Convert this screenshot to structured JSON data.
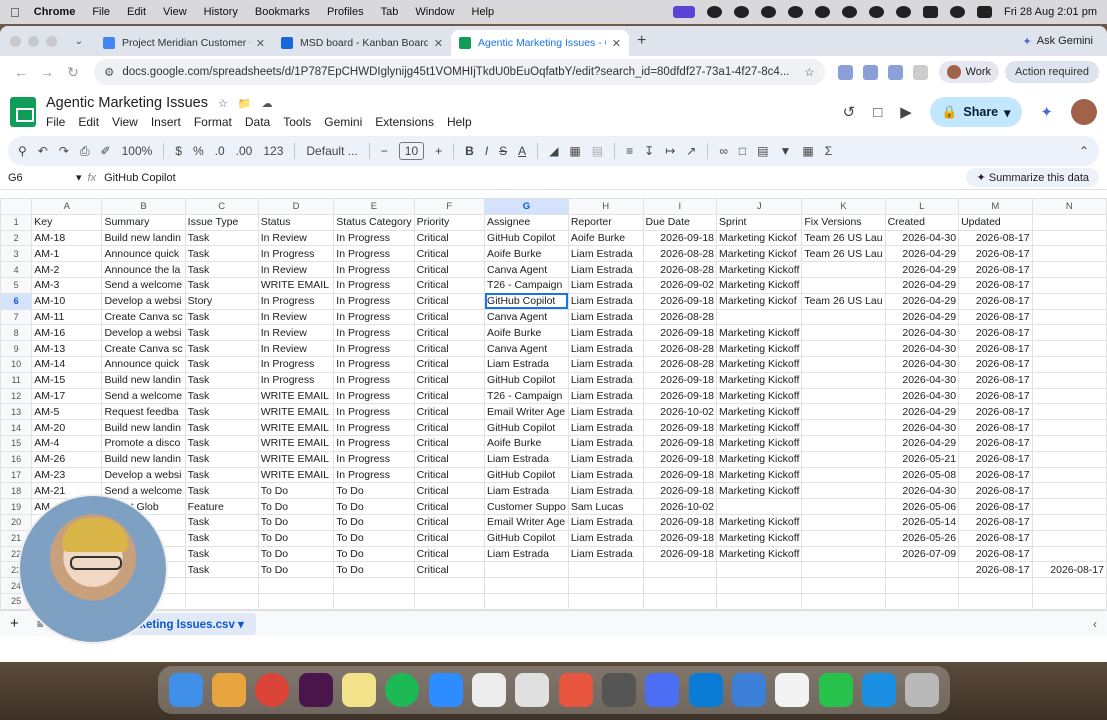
{
  "menubar": {
    "app": "Chrome",
    "items": [
      "File",
      "Edit",
      "View",
      "History",
      "Bookmarks",
      "Profiles",
      "Tab",
      "Window",
      "Help"
    ],
    "clock": "Fri 28 Aug  2:01 pm"
  },
  "tabs": [
    {
      "title": "Project Meridian Customer O",
      "color": "#4285f4"
    },
    {
      "title": "MSD board - Kanban Board -",
      "color": "#1868db"
    },
    {
      "title": "Agentic Marketing Issues - G",
      "color": "#0f9d58",
      "active": true
    }
  ],
  "ask_gemini": "Ask Gemini",
  "url": "docs.google.com/spreadsheets/d/1P787EpCHWDIglynijg45t1VOMHIjTkdU0bEuOqfatbY/edit?search_id=80dfdf27-73a1-4f27-8c4...",
  "profile_label": "Work",
  "action_required": "Action required",
  "doc": {
    "title": "Agentic Marketing Issues",
    "menus": [
      "File",
      "Edit",
      "View",
      "Insert",
      "Format",
      "Data",
      "Tools",
      "Gemini",
      "Extensions",
      "Help"
    ],
    "share": "Share"
  },
  "toolbar": {
    "zoom": "100%",
    "currency": "$",
    "percent": "%",
    "dec_minus": ".0",
    "dec_plus": ".00",
    "num_format": "123",
    "font": "Default ...",
    "font_size": "10"
  },
  "formula_bar": {
    "cell": "G6",
    "value": "GitHub Copilot",
    "summarize": "Summarize this data"
  },
  "grid": {
    "columns": [
      "A",
      "B",
      "C",
      "D",
      "E",
      "F",
      "G",
      "H",
      "I",
      "J",
      "K",
      "L",
      "M",
      "N"
    ],
    "rows": [
      [
        "1",
        "Key",
        "Summary",
        "Issue Type",
        "Status",
        "Status Category",
        "Priority",
        "Assignee",
        "Reporter",
        "Due Date",
        "Sprint",
        "Fix Versions",
        "Created",
        "Updated",
        ""
      ],
      [
        "2",
        "AM-18",
        "Build new landin",
        "Task",
        "In Review",
        "In Progress",
        "Critical",
        "GitHub Copilot",
        "Aoife Burke",
        "2026-09-18",
        "Marketing Kickof",
        "Team 26 US Lau",
        "2026-04-30",
        "2026-08-17",
        ""
      ],
      [
        "3",
        "AM-1",
        "Announce quick",
        "Task",
        "In Progress",
        "In Progress",
        "Critical",
        "Aoife Burke",
        "Liam Estrada",
        "2026-08-28",
        "Marketing Kickof",
        "Team 26 US Lau",
        "2026-04-29",
        "2026-08-17",
        ""
      ],
      [
        "4",
        "AM-2",
        "Announce the la",
        "Task",
        "In Review",
        "In Progress",
        "Critical",
        "Canva Agent",
        "Liam Estrada",
        "2026-08-28",
        "Marketing Kickoff",
        "",
        "2026-04-29",
        "2026-08-17",
        ""
      ],
      [
        "5",
        "AM-3",
        "Send a welcome",
        "Task",
        "WRITE EMAIL",
        "In Progress",
        "Critical",
        "T26 - Campaign",
        "Liam Estrada",
        "2026-09-02",
        "Marketing Kickoff",
        "",
        "2026-04-29",
        "2026-08-17",
        ""
      ],
      [
        "6",
        "AM-10",
        "Develop a websi",
        "Story",
        "In Progress",
        "In Progress",
        "Critical",
        "GitHub Copilot",
        "Liam Estrada",
        "2026-09-18",
        "Marketing Kickof",
        "Team 26 US Lau",
        "2026-04-29",
        "2026-08-17",
        ""
      ],
      [
        "7",
        "AM-11",
        "Create Canva sc",
        "Task",
        "In Review",
        "In Progress",
        "Critical",
        "Canva Agent",
        "Liam Estrada",
        "2026-08-28",
        "",
        "",
        "2026-04-29",
        "2026-08-17",
        ""
      ],
      [
        "8",
        "AM-16",
        "Develop a websi",
        "Task",
        "In Review",
        "In Progress",
        "Critical",
        "Aoife Burke",
        "Liam Estrada",
        "2026-09-18",
        "Marketing Kickoff",
        "",
        "2026-04-30",
        "2026-08-17",
        ""
      ],
      [
        "9",
        "AM-13",
        "Create Canva sc",
        "Task",
        "In Review",
        "In Progress",
        "Critical",
        "Canva Agent",
        "Liam Estrada",
        "2026-08-28",
        "Marketing Kickoff",
        "",
        "2026-04-30",
        "2026-08-17",
        ""
      ],
      [
        "10",
        "AM-14",
        "Announce quick",
        "Task",
        "In Progress",
        "In Progress",
        "Critical",
        "Liam Estrada",
        "Liam Estrada",
        "2026-08-28",
        "Marketing Kickoff",
        "",
        "2026-04-30",
        "2026-08-17",
        ""
      ],
      [
        "11",
        "AM-15",
        "Build new landin",
        "Task",
        "In Progress",
        "In Progress",
        "Critical",
        "GitHub Copilot",
        "Liam Estrada",
        "2026-09-18",
        "Marketing Kickoff",
        "",
        "2026-04-30",
        "2026-08-17",
        ""
      ],
      [
        "12",
        "AM-17",
        "Send a welcome",
        "Task",
        "WRITE EMAIL",
        "In Progress",
        "Critical",
        "T26 - Campaign",
        "Liam Estrada",
        "2026-09-18",
        "Marketing Kickoff",
        "",
        "2026-04-30",
        "2026-08-17",
        ""
      ],
      [
        "13",
        "AM-5",
        "Request feedba",
        "Task",
        "WRITE EMAIL",
        "In Progress",
        "Critical",
        "Email Writer Age",
        "Liam Estrada",
        "2026-10-02",
        "Marketing Kickoff",
        "",
        "2026-04-29",
        "2026-08-17",
        ""
      ],
      [
        "14",
        "AM-20",
        "Build new landin",
        "Task",
        "WRITE EMAIL",
        "In Progress",
        "Critical",
        "GitHub Copilot",
        "Liam Estrada",
        "2026-09-18",
        "Marketing Kickoff",
        "",
        "2026-04-30",
        "2026-08-17",
        ""
      ],
      [
        "15",
        "AM-4",
        "Promote a disco",
        "Task",
        "WRITE EMAIL",
        "In Progress",
        "Critical",
        "Aoife Burke",
        "Liam Estrada",
        "2026-09-18",
        "Marketing Kickoff",
        "",
        "2026-04-29",
        "2026-08-17",
        ""
      ],
      [
        "16",
        "AM-26",
        "Build new landin",
        "Task",
        "WRITE EMAIL",
        "In Progress",
        "Critical",
        "Liam Estrada",
        "Liam Estrada",
        "2026-09-18",
        "Marketing Kickoff",
        "",
        "2026-05-21",
        "2026-08-17",
        ""
      ],
      [
        "17",
        "AM-23",
        "Develop a websi",
        "Task",
        "WRITE EMAIL",
        "In Progress",
        "Critical",
        "GitHub Copilot",
        "Liam Estrada",
        "2026-09-18",
        "Marketing Kickoff",
        "",
        "2026-05-08",
        "2026-08-17",
        ""
      ],
      [
        "18",
        "AM-21",
        "Send a welcome",
        "Task",
        "To Do",
        "To Do",
        "Critical",
        "Liam Estrada",
        "Liam Estrada",
        "2026-09-18",
        "Marketing Kickoff",
        "",
        "2026-04-30",
        "2026-08-17",
        ""
      ],
      [
        "19",
        "AM",
        "ement Glob",
        "Feature",
        "To Do",
        "To Do",
        "Critical",
        "Customer Suppo",
        "Sam Lucas",
        "2026-10-02",
        "",
        "",
        "2026-05-06",
        "2026-08-17",
        ""
      ],
      [
        "20",
        "",
        "e quick",
        "Task",
        "To Do",
        "To Do",
        "Critical",
        "Email Writer Age",
        "Liam Estrada",
        "2026-09-18",
        "Marketing Kickoff",
        "",
        "2026-05-14",
        "2026-08-17",
        ""
      ],
      [
        "21",
        "",
        "andin",
        "Task",
        "To Do",
        "To Do",
        "Critical",
        "GitHub Copilot",
        "Liam Estrada",
        "2026-09-18",
        "Marketing Kickoff",
        "",
        "2026-05-26",
        "2026-08-17",
        ""
      ],
      [
        "22",
        "",
        "websi",
        "Task",
        "To Do",
        "To Do",
        "Critical",
        "Liam Estrada",
        "Liam Estrada",
        "2026-09-18",
        "Marketing Kickoff",
        "",
        "2026-07-09",
        "2026-08-17",
        ""
      ],
      [
        "23",
        "",
        "va sc",
        "Task",
        "To Do",
        "To Do",
        "Critical",
        "",
        "",
        "",
        "",
        "",
        "",
        "2026-08-17",
        "2026-08-17"
      ],
      [
        "24",
        "",
        "",
        "",
        "",
        "",
        "",
        "",
        "",
        "",
        "",
        "",
        "",
        "",
        ""
      ],
      [
        "25",
        "",
        "",
        "",
        "",
        "",
        "",
        "",
        "",
        "",
        "",
        "",
        "",
        "",
        ""
      ],
      [
        "26",
        "",
        "",
        "",
        "",
        "",
        "",
        "",
        "",
        "",
        "",
        "",
        "",
        "",
        ""
      ]
    ]
  },
  "sheet_tab": "Agentic Marketing Issues.csv"
}
